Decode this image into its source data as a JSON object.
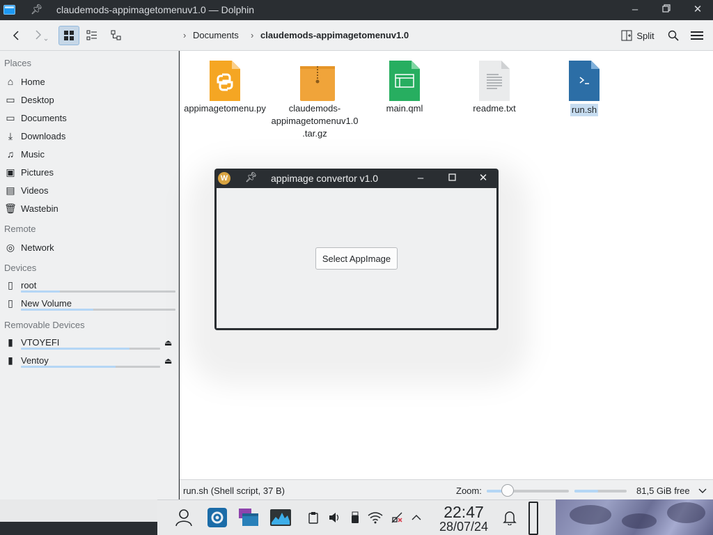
{
  "window": {
    "title": "claudemods-appimagetomenuv1.0 — Dolphin"
  },
  "toolbar": {
    "breadcrumb": [
      "Documents",
      "claudemods-appimagetomenuv1.0"
    ],
    "split_label": "Split"
  },
  "sidebar": {
    "places_header": "Places",
    "places": [
      {
        "label": "Home",
        "icon": "home-icon"
      },
      {
        "label": "Desktop",
        "icon": "desktop-icon"
      },
      {
        "label": "Documents",
        "icon": "documents-icon"
      },
      {
        "label": "Downloads",
        "icon": "downloads-icon"
      },
      {
        "label": "Music",
        "icon": "music-icon"
      },
      {
        "label": "Pictures",
        "icon": "pictures-icon"
      },
      {
        "label": "Videos",
        "icon": "videos-icon"
      },
      {
        "label": "Wastebin",
        "icon": "wastebin-icon"
      }
    ],
    "remote_header": "Remote",
    "remote": [
      {
        "label": "Network",
        "icon": "network-icon"
      }
    ],
    "devices_header": "Devices",
    "devices": [
      {
        "label": "root",
        "icon": "drive-icon",
        "usage": 0.25
      },
      {
        "label": "New Volume",
        "icon": "drive-icon",
        "usage": 0.47
      }
    ],
    "removable_header": "Removable Devices",
    "removable": [
      {
        "label": "VTOYEFI",
        "icon": "usb-drive-icon",
        "usage": 0.78
      },
      {
        "label": "Ventoy",
        "icon": "usb-drive-icon",
        "usage": 0.68
      }
    ]
  },
  "files": [
    {
      "name": "appimagetomenu.py",
      "type": "python",
      "color": "#f5a623"
    },
    {
      "name": "claudemods-appimagetomenuv1.0.tar.gz",
      "type": "archive",
      "color": "#f0a43a"
    },
    {
      "name": "main.qml",
      "type": "qml",
      "color": "#27ae60"
    },
    {
      "name": "readme.txt",
      "type": "text",
      "color": "#eaebec"
    },
    {
      "name": "run.sh",
      "type": "shell",
      "color": "#2c6ea6",
      "selected": true
    }
  ],
  "dialog": {
    "title": "appimage convertor v1.0",
    "button_label": "Select AppImage"
  },
  "statusbar": {
    "status_text": "run.sh (Shell script, 37 B)",
    "zoom_label": "Zoom:",
    "zoom_level": 0.25,
    "space_used": 0.45,
    "free_space": "81,5 GiB free"
  },
  "taskbar": {
    "time": "22:47",
    "date": "28/07/24"
  }
}
